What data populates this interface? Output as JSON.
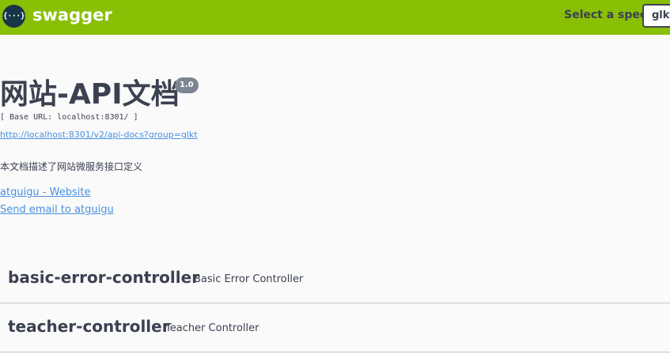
{
  "topbar": {
    "logo_icon_text": "{···}",
    "logo_text": "swagger",
    "spec_label": "Select a spec",
    "spec_selected": "glkt",
    "bg_color": "#89bf04"
  },
  "info": {
    "title": "网站-API文档",
    "version": "1.0",
    "base_url": "[ Base URL: localhost:8301/ ]",
    "api_docs_url": "http://localhost:8301/v2/api-docs?group=glkt",
    "description": "本文档描述了网站微服务接口定义",
    "contact_website": "atguigu - Website",
    "contact_email": "Send email to atguigu",
    "link_color": "#4990e2"
  },
  "tags": [
    {
      "name": "basic-error-controller",
      "description": "Basic Error Controller"
    },
    {
      "name": "teacher-controller",
      "description": "Teacher Controller"
    }
  ]
}
